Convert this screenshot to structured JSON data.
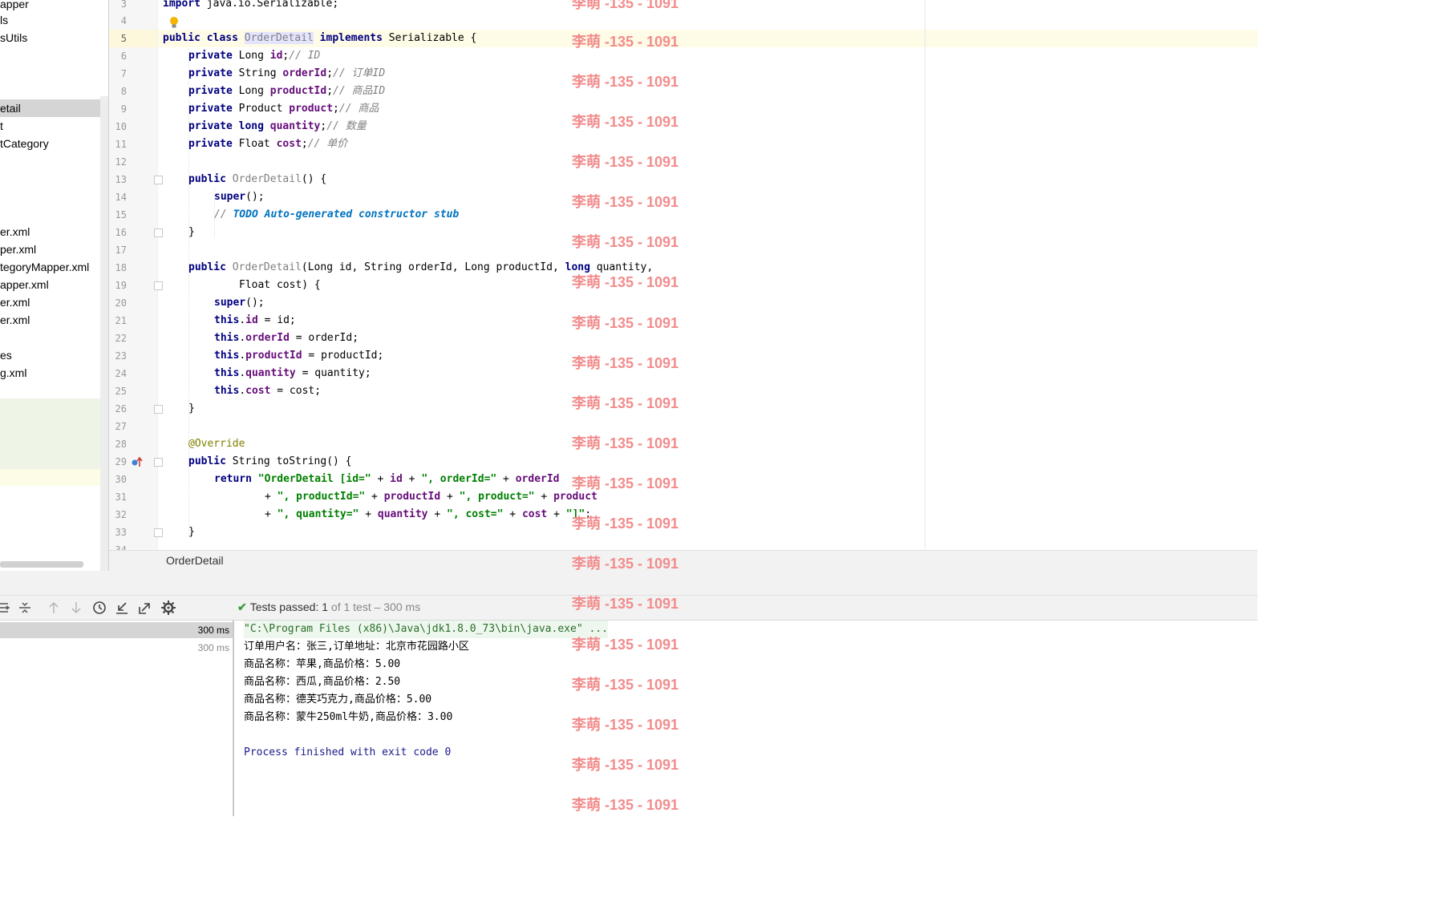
{
  "sidebar": {
    "items": [
      "apper",
      "ls",
      "sUtils",
      "etail",
      "t",
      "tCategory",
      "er.xml",
      "per.xml",
      "tegoryMapper.xml",
      "apper.xml",
      "er.xml",
      "er.xml",
      "es",
      "g.xml"
    ]
  },
  "editor": {
    "line_numbers": [
      "3",
      "4",
      "5",
      "6",
      "7",
      "8",
      "9",
      "10",
      "11",
      "12",
      "13",
      "14",
      "15",
      "16",
      "17",
      "18",
      "19",
      "20",
      "21",
      "22",
      "23",
      "24",
      "25",
      "26",
      "27",
      "28",
      "29",
      "30",
      "31",
      "32",
      "33",
      "34"
    ],
    "tokens": {
      "l3": [
        "import",
        " java.io.Serializable;"
      ],
      "l5": [
        "public class",
        " ",
        "OrderDetail",
        " ",
        "implements",
        " Serializable {"
      ],
      "private": "private",
      "l6": [
        "Long ",
        "id",
        ";",
        "// ID"
      ],
      "l7": [
        "String ",
        "orderId",
        ";",
        "// 订单ID"
      ],
      "l8": [
        "Long ",
        "productId",
        ";",
        "// 商品ID"
      ],
      "l9": [
        "Product ",
        "product",
        ";",
        "// 商品"
      ],
      "l10": [
        "long",
        " ",
        "quantity",
        ";",
        "// 数量"
      ],
      "l11": [
        "Float ",
        "cost",
        ";",
        "// 单价"
      ],
      "public": "public",
      "l13_name": "OrderDetail",
      "l13_rest": "() {",
      "super": "super",
      "super_rest": "();",
      "l15_slash": "// ",
      "l15_todo": "TODO Auto-generated constructor stub",
      "close_brace": "}",
      "l18_args": "(Long id, String orderId, Long productId, ",
      "l18_long": "long",
      "l18_end": " quantity,",
      "l19": "Float cost) {",
      "this": "this",
      "l21": [
        ".",
        "id",
        " = id;"
      ],
      "l22": [
        ".",
        "orderId",
        " = orderId;"
      ],
      "l23": [
        ".",
        "productId",
        " = productId;"
      ],
      "l24": [
        ".",
        "quantity",
        " = quantity;"
      ],
      "l25": [
        ".",
        "cost",
        " = cost;"
      ],
      "l28": "@Override",
      "l29_rest": " String toString() {",
      "return": "return",
      "l30": [
        "\"OrderDetail [id=\"",
        " + ",
        "id",
        " + ",
        "\", orderId=\"",
        " + ",
        "orderId"
      ],
      "l31": [
        "+ ",
        "\", productId=\"",
        " + ",
        "productId",
        " + ",
        "\", product=\"",
        " + ",
        "product"
      ],
      "l32": [
        "+ ",
        "\", quantity=\"",
        " + ",
        "quantity",
        " + ",
        "\", cost=\"",
        " + ",
        "cost",
        " + ",
        "\"]\"",
        ";"
      ]
    },
    "breadcrumb": "OrderDetail"
  },
  "run_panel": {
    "status_prefix": "Tests passed:",
    "status_count": "1",
    "status_rest": "of 1 test – 300 ms",
    "tree_times": [
      "300 ms",
      "300 ms"
    ],
    "console_lines": [
      "\"C:\\Program Files (x86)\\Java\\jdk1.8.0_73\\bin\\java.exe\" ...",
      "订单用户名：张三,订单地址：北京市花园路小区",
      "商品名称：苹果,商品价格：5.00",
      "商品名称：西瓜,商品价格：2.50",
      "商品名称：德芙巧克力,商品价格：5.00",
      "商品名称：蒙牛250ml牛奶,商品价格：3.00",
      "",
      "Process finished with exit code 0"
    ]
  },
  "watermark": "李萌 -135 - 1091",
  "icons": [
    "expand-all-icon",
    "collapse-all-icon",
    "previous-icon",
    "next-icon",
    "history-icon",
    "import-icon",
    "export-icon",
    "settings-icon",
    "lightbulb-icon",
    "override-marker-icon",
    "check-icon"
  ]
}
